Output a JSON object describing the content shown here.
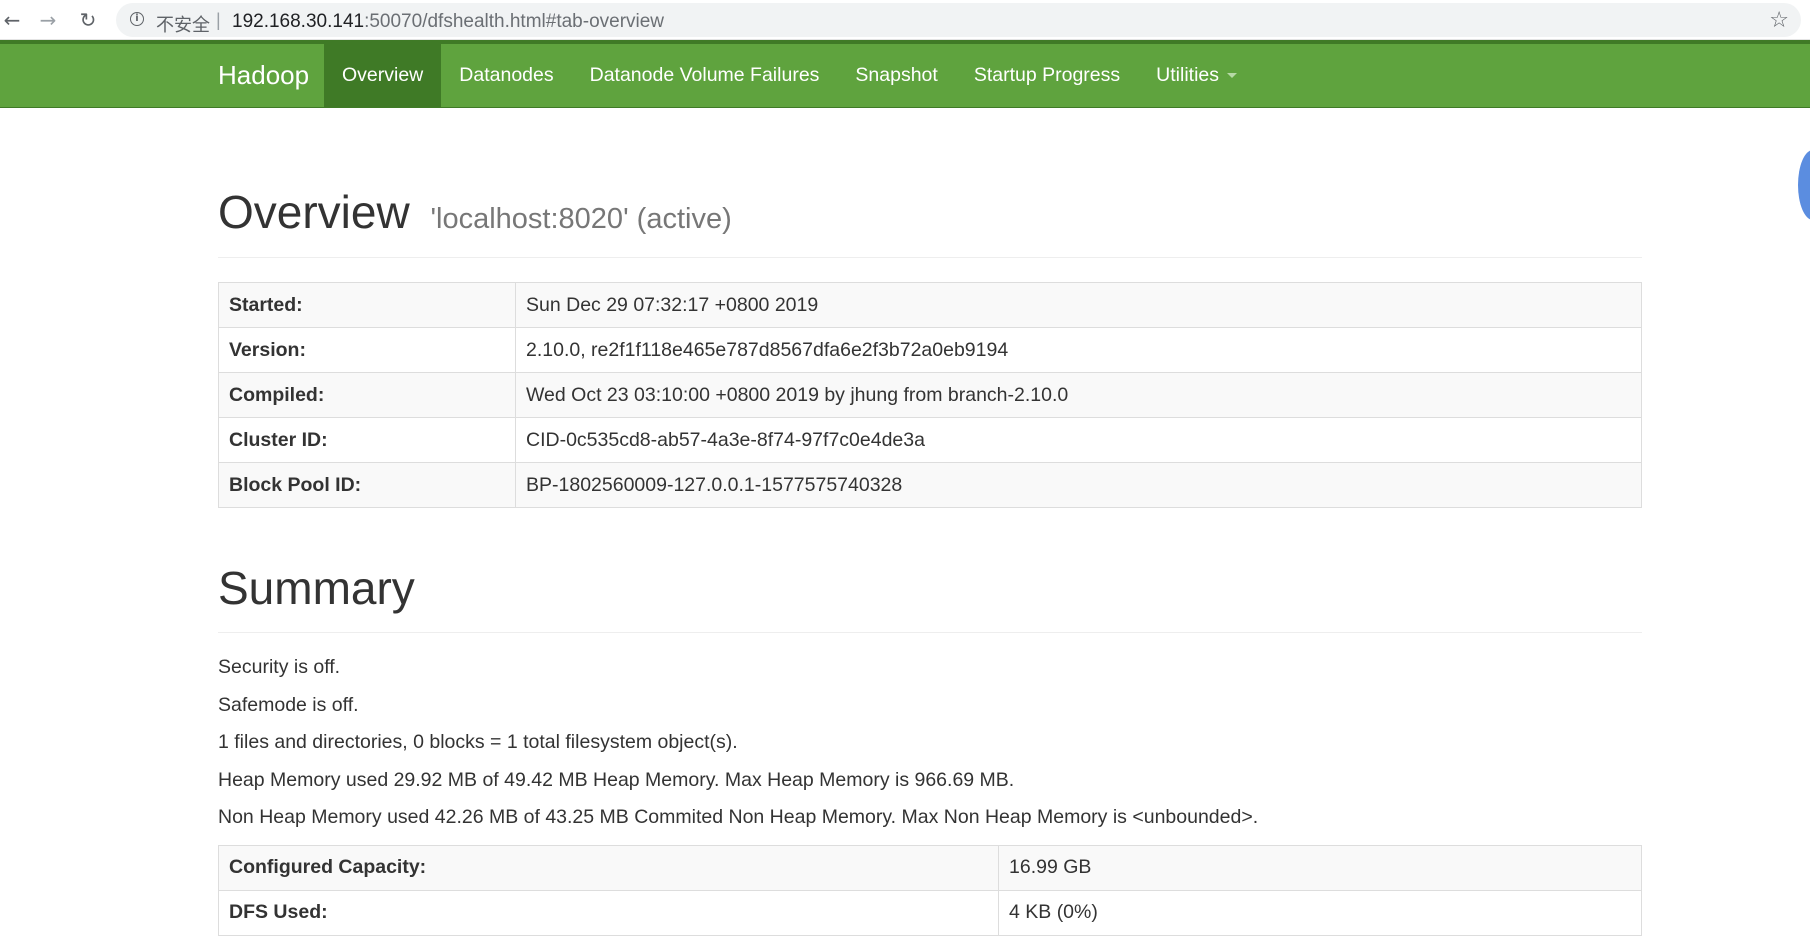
{
  "browser": {
    "back_icon": "back-arrow-icon",
    "forward_icon": "forward-arrow-icon",
    "reload_icon": "reload-icon",
    "info_icon": "info-icon",
    "security_label": "不安全",
    "separator": "|",
    "url_host": "192.168.30.141",
    "url_path": ":50070/dfshealth.html#tab-overview",
    "bookmark_icon": "star-icon"
  },
  "navbar": {
    "brand": "Hadoop",
    "items": [
      {
        "label": "Overview",
        "active": true
      },
      {
        "label": "Datanodes",
        "active": false
      },
      {
        "label": "Datanode Volume Failures",
        "active": false
      },
      {
        "label": "Snapshot",
        "active": false
      },
      {
        "label": "Startup Progress",
        "active": false
      },
      {
        "label": "Utilities",
        "active": false,
        "dropdown": true
      }
    ],
    "colors": {
      "background": "#5fa33e",
      "active": "#3f7a26"
    }
  },
  "overview": {
    "title": "Overview",
    "subtitle": "'localhost:8020' (active)",
    "rows": [
      {
        "key": "Started:",
        "value": "Sun Dec 29 07:32:17 +0800 2019"
      },
      {
        "key": "Version:",
        "value": "2.10.0, re2f1f118e465e787d8567dfa6e2f3b72a0eb9194"
      },
      {
        "key": "Compiled:",
        "value": "Wed Oct 23 03:10:00 +0800 2019 by jhung from branch-2.10.0"
      },
      {
        "key": "Cluster ID:",
        "value": "CID-0c535cd8-ab57-4a3e-8f74-97f7c0e4de3a"
      },
      {
        "key": "Block Pool ID:",
        "value": "BP-1802560009-127.0.0.1-1577575740328"
      }
    ]
  },
  "summary": {
    "title": "Summary",
    "lines": [
      "Security is off.",
      "Safemode is off.",
      "1 files and directories, 0 blocks = 1 total filesystem object(s).",
      "Heap Memory used 29.92 MB of 49.42 MB Heap Memory. Max Heap Memory is 966.69 MB.",
      "Non Heap Memory used 42.26 MB of 43.25 MB Commited Non Heap Memory. Max Non Heap Memory is <unbounded>."
    ],
    "rows": [
      {
        "key": "Configured Capacity:",
        "value": "16.99 GB"
      },
      {
        "key": "DFS Used:",
        "value": "4 KB (0%)"
      }
    ]
  }
}
